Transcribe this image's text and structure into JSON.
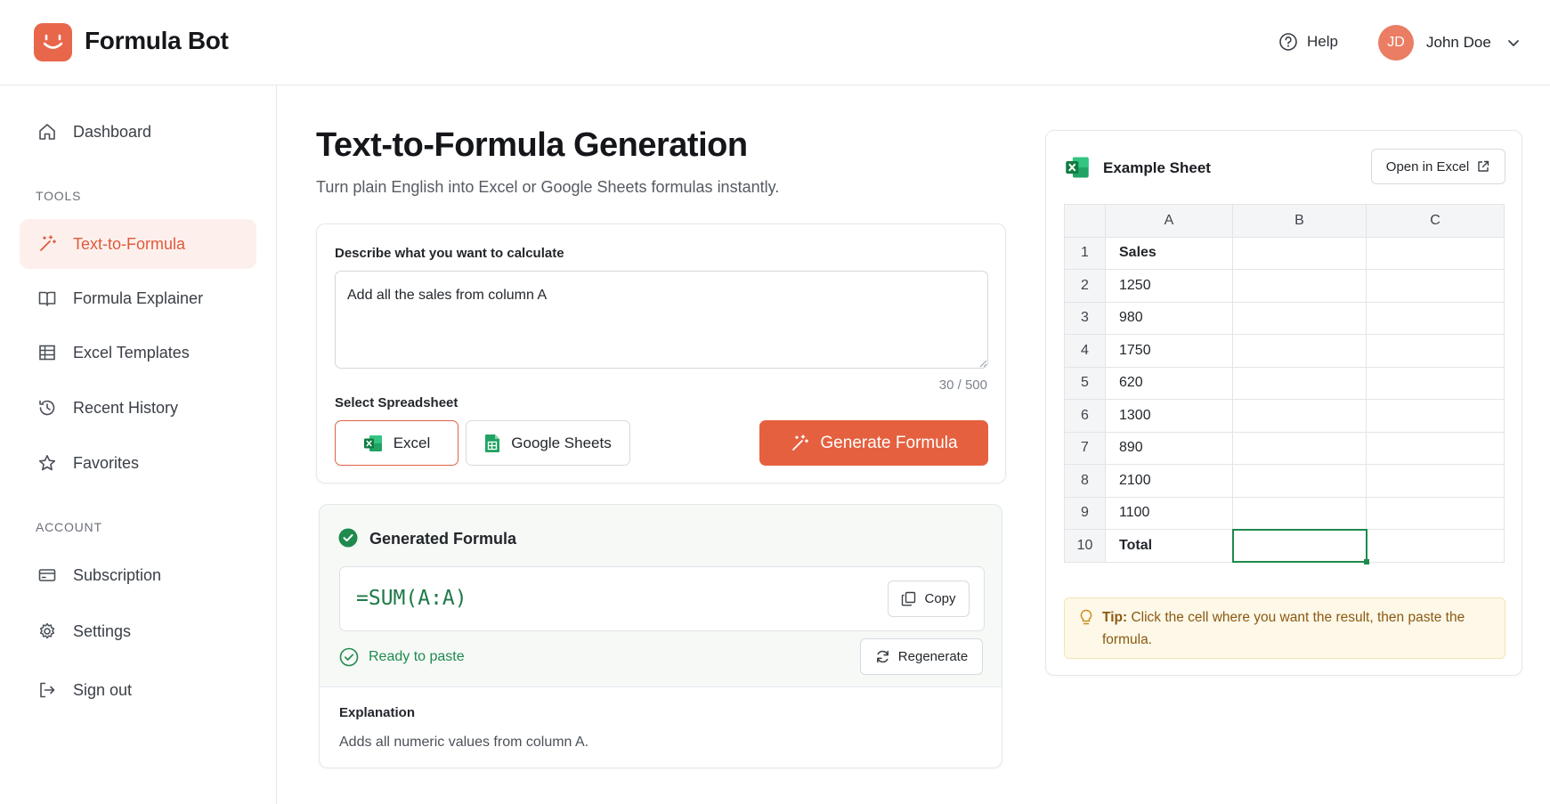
{
  "header": {
    "brand": "Formula Bot",
    "help_label": "Help",
    "user_initials": "JD",
    "user_name": "John Doe"
  },
  "sidebar": {
    "dashboard": "Dashboard",
    "tools_heading": "TOOLS",
    "tools": [
      {
        "label": "Text-to-Formula",
        "icon": "magic-wand-icon",
        "active": true
      },
      {
        "label": "Formula Explainer",
        "icon": "book-icon"
      },
      {
        "label": "Excel Templates",
        "icon": "table-icon"
      },
      {
        "label": "Recent History",
        "icon": "history-icon"
      },
      {
        "label": "Favorites",
        "icon": "star-icon"
      }
    ],
    "account_heading": "ACCOUNT",
    "account": [
      {
        "label": "Subscription",
        "icon": "credit-card-icon"
      },
      {
        "label": "Settings",
        "icon": "gear-icon"
      },
      {
        "label": "Sign out",
        "icon": "sign-out-icon"
      }
    ]
  },
  "main": {
    "title": "Text-to-Formula Generation",
    "subtitle": "Turn plain English into Excel or Google Sheets formulas instantly.",
    "prompt_label": "Describe what you want to calculate",
    "prompt_value": "Add all the sales from column A",
    "char_count": "30 / 500",
    "spreadsheet_label": "Select Spreadsheet",
    "excel_label": "Excel",
    "sheets_label": "Google Sheets",
    "generate_label": "Generate Formula"
  },
  "result": {
    "heading": "Generated Formula",
    "formula": "=SUM(A:A)",
    "copy_label": "Copy",
    "status": "Ready to paste",
    "regenerate_label": "Regenerate",
    "explanation_heading": "Explanation",
    "explanation": "Adds all numeric values from column A."
  },
  "sheet": {
    "title": "Example Sheet",
    "open_label": "Open in Excel",
    "columns": [
      "A",
      "B",
      "C"
    ],
    "rows": [
      {
        "n": "1",
        "a": "Sales",
        "bold": true
      },
      {
        "n": "2",
        "a": "1250"
      },
      {
        "n": "3",
        "a": "980"
      },
      {
        "n": "4",
        "a": "1750"
      },
      {
        "n": "5",
        "a": "620"
      },
      {
        "n": "6",
        "a": "1300"
      },
      {
        "n": "7",
        "a": "890"
      },
      {
        "n": "8",
        "a": "2100"
      },
      {
        "n": "9",
        "a": "1100"
      },
      {
        "n": "10",
        "a": "Total",
        "bold": true
      }
    ],
    "tip_label": "Tip:",
    "tip_text": "Click the cell where you want the result, then paste the formula."
  },
  "colors": {
    "accent": "#e5603f",
    "success": "#1f8a4e"
  }
}
